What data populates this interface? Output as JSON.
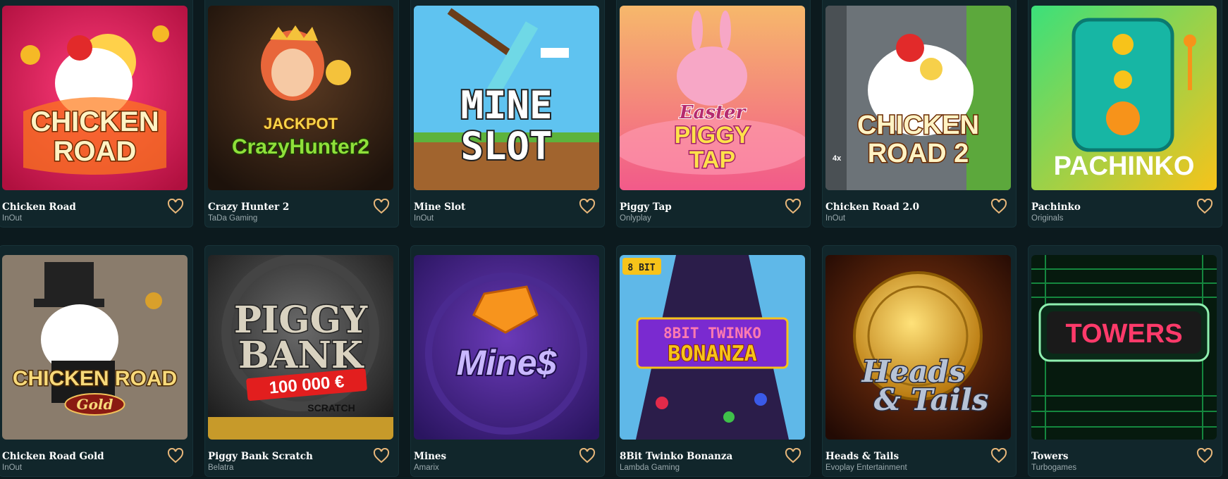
{
  "games": [
    {
      "title": "Chicken Road",
      "provider": "InOut",
      "art_text": [
        "CHICKEN",
        "ROAD"
      ]
    },
    {
      "title": "Crazy Hunter 2",
      "provider": "TaDa Gaming",
      "art_text": [
        "JACKPOT",
        "CrazyHunter2"
      ]
    },
    {
      "title": "Mine Slot",
      "provider": "InOut",
      "art_text": [
        "MINE",
        "SLOT"
      ]
    },
    {
      "title": "Piggy Tap",
      "provider": "Onlyplay",
      "art_text": [
        "Easter",
        "PIGGY",
        "TAP"
      ]
    },
    {
      "title": "Chicken Road 2.0",
      "provider": "InOut",
      "art_text": [
        "CHICKEN",
        "ROAD 2",
        "4x"
      ]
    },
    {
      "title": "Pachinko",
      "provider": "Originals",
      "art_text": [
        "PACHINKO"
      ]
    },
    {
      "title": "Chicken Road Gold",
      "provider": "InOut",
      "art_text": [
        "CHICKEN ROAD",
        "Gold"
      ]
    },
    {
      "title": "Piggy Bank Scratch",
      "provider": "Belatra",
      "art_text": [
        "PIGGY",
        "BANK",
        "100 000 €",
        "SCRATCH"
      ]
    },
    {
      "title": "Mines",
      "provider": "Amarix",
      "art_text": [
        "Mine$"
      ]
    },
    {
      "title": "8Bit Twinko Bonanza",
      "provider": "Lambda Gaming",
      "art_text": [
        "8 BIT",
        "8BIT TWINKO",
        "BONANZA"
      ]
    },
    {
      "title": "Heads & Tails",
      "provider": "Evoplay Entertainment",
      "art_text": [
        "Heads",
        "& Tails"
      ]
    },
    {
      "title": "Towers",
      "provider": "Turbogames",
      "art_text": [
        "TOWERS"
      ]
    }
  ],
  "colors": {
    "background": "#0c1a1e",
    "card": "#11262b",
    "heart": "#e8b77a"
  },
  "icons": {
    "favorite": "heart-outline-icon"
  }
}
